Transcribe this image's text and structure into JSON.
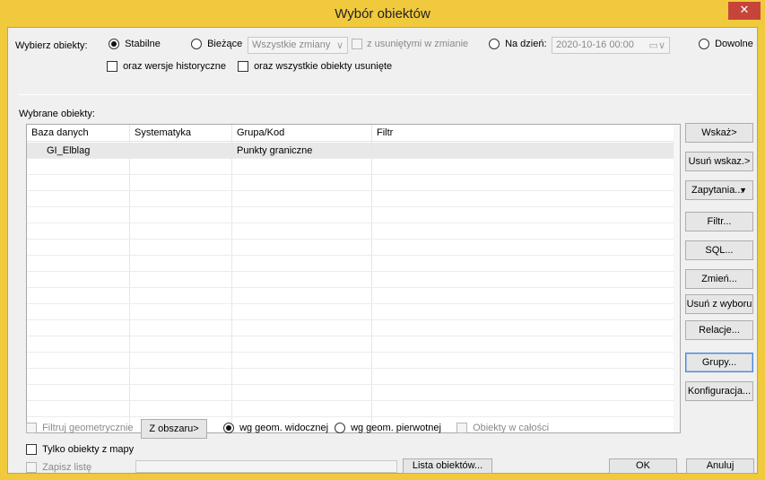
{
  "window": {
    "title": "Wybór obiektów",
    "close_glyph": "✕"
  },
  "selection": {
    "label": "Wybierz obiekty:",
    "radio_stable": "Stabilne",
    "radio_current": "Bieżące",
    "changes_combo": "Wszystkie zmiany",
    "deleted_in_change": "z usuniętymi w zmianie",
    "radio_on_date": "Na dzień:",
    "date_value": "2020-10-16 00:00",
    "radio_any": "Dowolne",
    "historical_versions": "oraz wersje historyczne",
    "all_deleted": "oraz wszystkie obiekty usunięte",
    "selected_option": "Stabilne"
  },
  "selected_objects": {
    "label": "Wybrane obiekty:",
    "columns": [
      "Baza danych",
      "Systematyka",
      "Grupa/Kod",
      "Filtr"
    ],
    "rows": [
      {
        "database": "GI_Elblag",
        "systematics": "",
        "group_code": "Punkty graniczne",
        "filter": ""
      }
    ]
  },
  "side_buttons": {
    "point": "Wskaż>",
    "remove_point": "Usuń wskaz.>",
    "queries": "Zapytania...",
    "queries_arrow": "▼",
    "filter": "Filtr...",
    "sql": "SQL...",
    "change": "Zmień...",
    "remove_from_selection": "Usuń z wyboru",
    "relations": "Relacje...",
    "groups": "Grupy...",
    "configuration": "Konfiguracja..."
  },
  "bottom": {
    "geom_filter": "Filtruj geometrycznie",
    "from_area": "Z obszaru>",
    "visible_geom": "wg geom. widocznej",
    "original_geom": "wg geom. pierwotnej",
    "whole_objects": "Obiekty w całości",
    "map_objects_only": "Tylko obiekty z mapy",
    "save_list": "Zapisz listę",
    "object_list": "Lista obiektów...",
    "ok": "OK",
    "cancel": "Anuluj"
  }
}
